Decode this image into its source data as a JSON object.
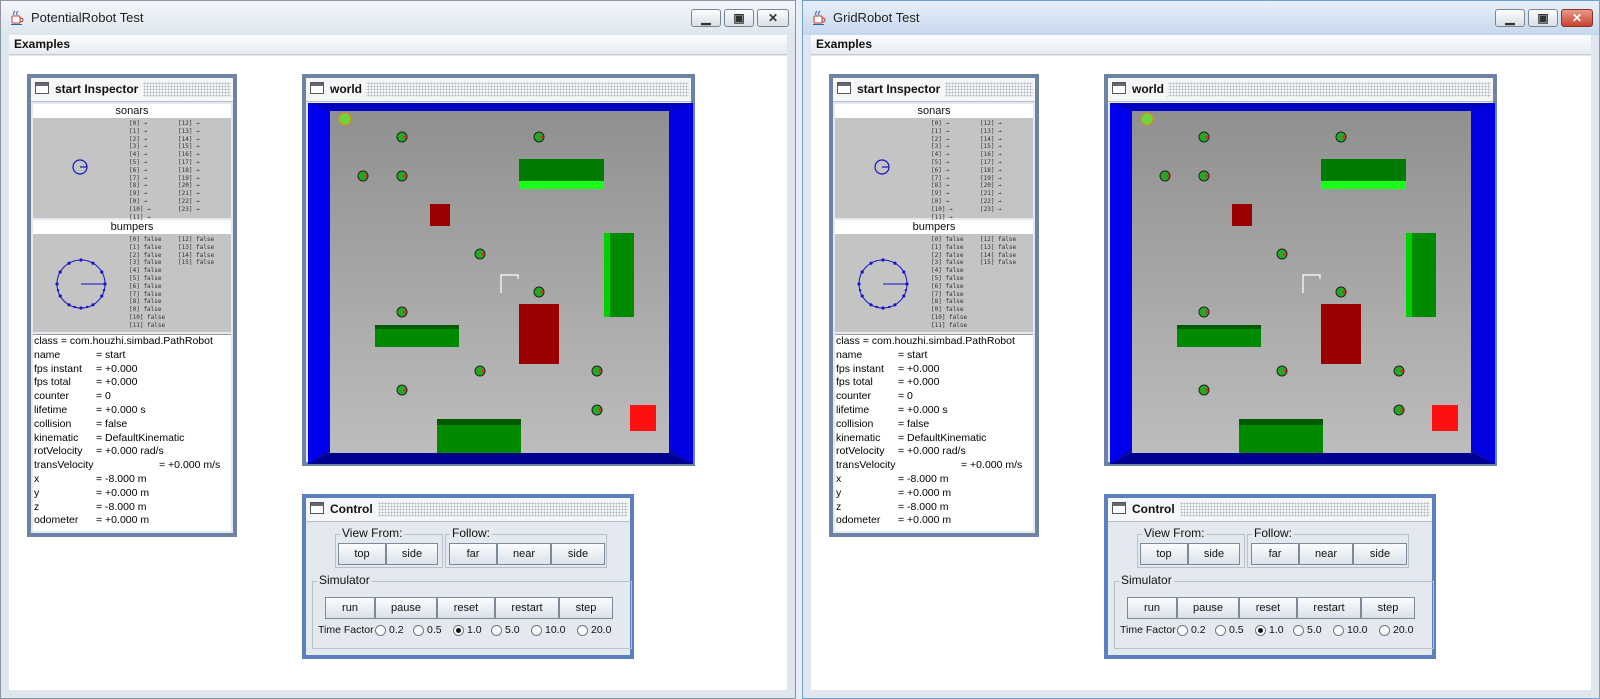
{
  "windows": [
    {
      "title": "PotentialRobot Test",
      "menu": {
        "examples": "Examples"
      },
      "inspector": {
        "title": "start Inspector",
        "sonars_label": "sonars",
        "bumpers_label": "bumpers",
        "sonar_lines_left": "[0] →\n[1] →\n[2] →\n[3] →\n[4] →\n[5] →\n[6] →\n[7] →\n[8] →\n[9] →\n[0] →\n[10] →\n[11] →",
        "sonar_lines_right": "[12] →\n[13] →\n[14] →\n[15] →\n[16] →\n[17] →\n[18] →\n[19] →\n[20] →\n[21] →\n[22] →\n[23] →",
        "bumper_lines_left": "[0] false\n[1] false\n[2] false\n[3] false\n[4] false\n[5] false\n[6] false\n[7] false\n[8] false\n[0] false\n[10] false\n[11] false",
        "bumper_lines_right": "[12] false\n[13] false\n[14] false\n[15] false",
        "class_line": "class = com.houzhi.simbad.PathRobot",
        "props": [
          {
            "k": "name",
            "v": "= start"
          },
          {
            "k": "fps instant",
            "v": "= +0.000"
          },
          {
            "k": "fps total",
            "v": "= +0.000"
          },
          {
            "k": "counter",
            "v": "= 0"
          },
          {
            "k": "lifetime",
            "v": "= +0.000 s"
          },
          {
            "k": "collision",
            "v": "= false"
          },
          {
            "k": "kinematic",
            "v": "= DefaultKinematic"
          },
          {
            "k": "rotVelocity",
            "v": "= +0.000 rad/s"
          },
          {
            "k": "transVelocity",
            "v": "= +0.000 m/s"
          },
          {
            "k": "x",
            "v": "= -8.000 m"
          },
          {
            "k": "y",
            "v": "= +0.000 m"
          },
          {
            "k": "z",
            "v": "= -8.000 m"
          },
          {
            "k": "odometer",
            "v": "= +0.000 m"
          }
        ]
      },
      "world": {
        "title": "world"
      },
      "control": {
        "title": "Control",
        "view_from": "View From:",
        "view_buttons": [
          "top",
          "side"
        ],
        "follow": "Follow:",
        "follow_buttons": [
          "far",
          "near",
          "side"
        ],
        "simulator": "Simulator",
        "sim_buttons": [
          "run",
          "pause",
          "reset",
          "restart",
          "step"
        ],
        "time_factor_label": "Time Factor",
        "time_factors": [
          "0.2",
          "0.5",
          "1.0",
          "5.0",
          "10.0",
          "20.0"
        ],
        "selected_time_factor": "1.0"
      }
    },
    {
      "title": "GridRobot Test",
      "menu": {
        "examples": "Examples"
      },
      "inspector": {
        "title": "start Inspector",
        "sonars_label": "sonars",
        "bumpers_label": "bumpers",
        "sonar_lines_left": "[0] →\n[1] →\n[2] →\n[3] →\n[4] →\n[5] →\n[6] →\n[7] →\n[8] →\n[9] →\n[0] →\n[10] →\n[11] →",
        "sonar_lines_right": "[12] →\n[13] →\n[14] →\n[15] →\n[16] →\n[17] →\n[18] →\n[19] →\n[20] →\n[21] →\n[22] →\n[23] →",
        "bumper_lines_left": "[0] false\n[1] false\n[2] false\n[3] false\n[4] false\n[5] false\n[6] false\n[7] false\n[8] false\n[0] false\n[10] false\n[11] false",
        "bumper_lines_right": "[12] false\n[13] false\n[14] false\n[15] false",
        "class_line": "class = com.houzhi.simbad.PathRobot",
        "props": [
          {
            "k": "name",
            "v": "= start"
          },
          {
            "k": "fps instant",
            "v": "= +0.000"
          },
          {
            "k": "fps total",
            "v": "= +0.000"
          },
          {
            "k": "counter",
            "v": "= 0"
          },
          {
            "k": "lifetime",
            "v": "= +0.000 s"
          },
          {
            "k": "collision",
            "v": "= false"
          },
          {
            "k": "kinematic",
            "v": "= DefaultKinematic"
          },
          {
            "k": "rotVelocity",
            "v": "= +0.000 rad/s"
          },
          {
            "k": "transVelocity",
            "v": "= +0.000 m/s"
          },
          {
            "k": "x",
            "v": "= -8.000 m"
          },
          {
            "k": "y",
            "v": "= +0.000 m"
          },
          {
            "k": "z",
            "v": "= -8.000 m"
          },
          {
            "k": "odometer",
            "v": "= +0.000 m"
          }
        ]
      },
      "world": {
        "title": "world"
      },
      "control": {
        "title": "Control",
        "view_from": "View From:",
        "view_buttons": [
          "top",
          "side"
        ],
        "follow": "Follow:",
        "follow_buttons": [
          "far",
          "near",
          "side"
        ],
        "simulator": "Simulator",
        "sim_buttons": [
          "run",
          "pause",
          "reset",
          "restart",
          "step"
        ],
        "time_factor_label": "Time Factor",
        "time_factors": [
          "0.2",
          "0.5",
          "1.0",
          "5.0",
          "10.0",
          "20.0"
        ],
        "selected_time_factor": "1.0"
      }
    }
  ],
  "colors": {
    "floor": "#a8a8a8",
    "wall": "#0000d8",
    "box_green": "#008a00",
    "box_red": "#9a0000",
    "goal_red": "#ff1010",
    "robot_green": "#22aa22"
  },
  "icons": {
    "app_icon": "java-coffee-cup-icon",
    "frame_icon": "internal-frame-icon",
    "minimize": "minimize-icon",
    "maximize": "maximize-icon",
    "close": "close-icon"
  }
}
